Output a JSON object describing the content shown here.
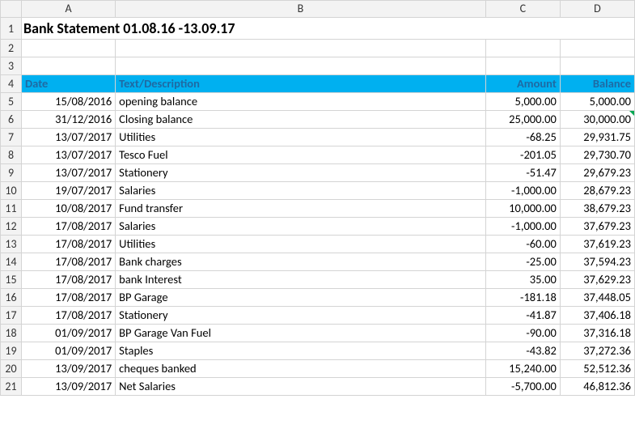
{
  "columns": [
    "A",
    "B",
    "C",
    "D"
  ],
  "title": "Bank Statement 01.08.16 -13.09.17",
  "header": {
    "date": "Date",
    "desc": "Text/Description",
    "amount": "Amount",
    "balance": "Balance"
  },
  "rows": [
    {
      "r": 5,
      "date": "15/08/2016",
      "desc": "opening balance",
      "amount": "5,000.00",
      "balance": "5,000.00"
    },
    {
      "r": 6,
      "date": "31/12/2016",
      "desc": "Closing balance",
      "amount": "25,000.00",
      "balance": "30,000.00",
      "mark": true
    },
    {
      "r": 7,
      "date": "13/07/2017",
      "desc": "Utilities",
      "amount": "-68.25",
      "balance": "29,931.75"
    },
    {
      "r": 8,
      "date": "13/07/2017",
      "desc": "Tesco Fuel",
      "amount": "-201.05",
      "balance": "29,730.70"
    },
    {
      "r": 9,
      "date": "13/07/2017",
      "desc": "Stationery",
      "amount": "-51.47",
      "balance": "29,679.23"
    },
    {
      "r": 10,
      "date": "19/07/2017",
      "desc": "Salaries",
      "amount": "-1,000.00",
      "balance": "28,679.23"
    },
    {
      "r": 11,
      "date": "10/08/2017",
      "desc": "Fund transfer",
      "amount": "10,000.00",
      "balance": "38,679.23"
    },
    {
      "r": 12,
      "date": "17/08/2017",
      "desc": "Salaries",
      "amount": "-1,000.00",
      "balance": "37,679.23"
    },
    {
      "r": 13,
      "date": "17/08/2017",
      "desc": "Utilities",
      "amount": "-60.00",
      "balance": "37,619.23"
    },
    {
      "r": 14,
      "date": "17/08/2017",
      "desc": "Bank charges",
      "amount": "-25.00",
      "balance": "37,594.23"
    },
    {
      "r": 15,
      "date": "17/08/2017",
      "desc": "bank Interest",
      "amount": "35.00",
      "balance": "37,629.23"
    },
    {
      "r": 16,
      "date": "17/08/2017",
      "desc": "BP Garage",
      "amount": "-181.18",
      "balance": "37,448.05"
    },
    {
      "r": 17,
      "date": "17/08/2017",
      "desc": "Stationery",
      "amount": "-41.87",
      "balance": "37,406.18"
    },
    {
      "r": 18,
      "date": "01/09/2017",
      "desc": "BP Garage Van Fuel",
      "amount": "-90.00",
      "balance": "37,316.18"
    },
    {
      "r": 19,
      "date": "01/09/2017",
      "desc": "Staples",
      "amount": "-43.82",
      "balance": "37,272.36"
    },
    {
      "r": 20,
      "date": "13/09/2017",
      "desc": "cheques banked",
      "amount": "15,240.00",
      "balance": "52,512.36"
    },
    {
      "r": 21,
      "date": "13/09/2017",
      "desc": "Net Salaries",
      "amount": "-5,700.00",
      "balance": "46,812.36"
    }
  ]
}
